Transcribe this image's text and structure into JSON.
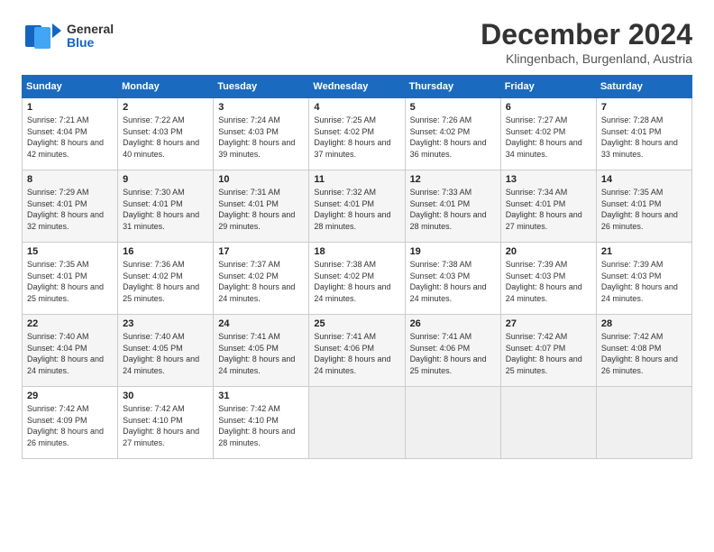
{
  "header": {
    "logo_general": "General",
    "logo_blue": "Blue",
    "title": "December 2024",
    "subtitle": "Klingenbach, Burgenland, Austria"
  },
  "calendar": {
    "days_of_week": [
      "Sunday",
      "Monday",
      "Tuesday",
      "Wednesday",
      "Thursday",
      "Friday",
      "Saturday"
    ],
    "weeks": [
      [
        {
          "day": "",
          "empty": true
        },
        {
          "day": "",
          "empty": true
        },
        {
          "day": "",
          "empty": true
        },
        {
          "day": "",
          "empty": true
        },
        {
          "day": "",
          "empty": true
        },
        {
          "day": "",
          "empty": true
        },
        {
          "day": "",
          "empty": true
        }
      ],
      [
        {
          "day": "1",
          "sunrise": "7:21 AM",
          "sunset": "4:04 PM",
          "daylight": "8 hours and 42 minutes."
        },
        {
          "day": "2",
          "sunrise": "7:22 AM",
          "sunset": "4:03 PM",
          "daylight": "8 hours and 40 minutes."
        },
        {
          "day": "3",
          "sunrise": "7:24 AM",
          "sunset": "4:03 PM",
          "daylight": "8 hours and 39 minutes."
        },
        {
          "day": "4",
          "sunrise": "7:25 AM",
          "sunset": "4:02 PM",
          "daylight": "8 hours and 37 minutes."
        },
        {
          "day": "5",
          "sunrise": "7:26 AM",
          "sunset": "4:02 PM",
          "daylight": "8 hours and 36 minutes."
        },
        {
          "day": "6",
          "sunrise": "7:27 AM",
          "sunset": "4:02 PM",
          "daylight": "8 hours and 34 minutes."
        },
        {
          "day": "7",
          "sunrise": "7:28 AM",
          "sunset": "4:01 PM",
          "daylight": "8 hours and 33 minutes."
        }
      ],
      [
        {
          "day": "8",
          "sunrise": "7:29 AM",
          "sunset": "4:01 PM",
          "daylight": "8 hours and 32 minutes."
        },
        {
          "day": "9",
          "sunrise": "7:30 AM",
          "sunset": "4:01 PM",
          "daylight": "8 hours and 31 minutes."
        },
        {
          "day": "10",
          "sunrise": "7:31 AM",
          "sunset": "4:01 PM",
          "daylight": "8 hours and 29 minutes."
        },
        {
          "day": "11",
          "sunrise": "7:32 AM",
          "sunset": "4:01 PM",
          "daylight": "8 hours and 28 minutes."
        },
        {
          "day": "12",
          "sunrise": "7:33 AM",
          "sunset": "4:01 PM",
          "daylight": "8 hours and 28 minutes."
        },
        {
          "day": "13",
          "sunrise": "7:34 AM",
          "sunset": "4:01 PM",
          "daylight": "8 hours and 27 minutes."
        },
        {
          "day": "14",
          "sunrise": "7:35 AM",
          "sunset": "4:01 PM",
          "daylight": "8 hours and 26 minutes."
        }
      ],
      [
        {
          "day": "15",
          "sunrise": "7:35 AM",
          "sunset": "4:01 PM",
          "daylight": "8 hours and 25 minutes."
        },
        {
          "day": "16",
          "sunrise": "7:36 AM",
          "sunset": "4:02 PM",
          "daylight": "8 hours and 25 minutes."
        },
        {
          "day": "17",
          "sunrise": "7:37 AM",
          "sunset": "4:02 PM",
          "daylight": "8 hours and 24 minutes."
        },
        {
          "day": "18",
          "sunrise": "7:38 AM",
          "sunset": "4:02 PM",
          "daylight": "8 hours and 24 minutes."
        },
        {
          "day": "19",
          "sunrise": "7:38 AM",
          "sunset": "4:03 PM",
          "daylight": "8 hours and 24 minutes."
        },
        {
          "day": "20",
          "sunrise": "7:39 AM",
          "sunset": "4:03 PM",
          "daylight": "8 hours and 24 minutes."
        },
        {
          "day": "21",
          "sunrise": "7:39 AM",
          "sunset": "4:03 PM",
          "daylight": "8 hours and 24 minutes."
        }
      ],
      [
        {
          "day": "22",
          "sunrise": "7:40 AM",
          "sunset": "4:04 PM",
          "daylight": "8 hours and 24 minutes."
        },
        {
          "day": "23",
          "sunrise": "7:40 AM",
          "sunset": "4:05 PM",
          "daylight": "8 hours and 24 minutes."
        },
        {
          "day": "24",
          "sunrise": "7:41 AM",
          "sunset": "4:05 PM",
          "daylight": "8 hours and 24 minutes."
        },
        {
          "day": "25",
          "sunrise": "7:41 AM",
          "sunset": "4:06 PM",
          "daylight": "8 hours and 24 minutes."
        },
        {
          "day": "26",
          "sunrise": "7:41 AM",
          "sunset": "4:06 PM",
          "daylight": "8 hours and 25 minutes."
        },
        {
          "day": "27",
          "sunrise": "7:42 AM",
          "sunset": "4:07 PM",
          "daylight": "8 hours and 25 minutes."
        },
        {
          "day": "28",
          "sunrise": "7:42 AM",
          "sunset": "4:08 PM",
          "daylight": "8 hours and 26 minutes."
        }
      ],
      [
        {
          "day": "29",
          "sunrise": "7:42 AM",
          "sunset": "4:09 PM",
          "daylight": "8 hours and 26 minutes."
        },
        {
          "day": "30",
          "sunrise": "7:42 AM",
          "sunset": "4:10 PM",
          "daylight": "8 hours and 27 minutes."
        },
        {
          "day": "31",
          "sunrise": "7:42 AM",
          "sunset": "4:10 PM",
          "daylight": "8 hours and 28 minutes."
        },
        {
          "day": "",
          "empty": true
        },
        {
          "day": "",
          "empty": true
        },
        {
          "day": "",
          "empty": true
        },
        {
          "day": "",
          "empty": true
        }
      ]
    ]
  }
}
